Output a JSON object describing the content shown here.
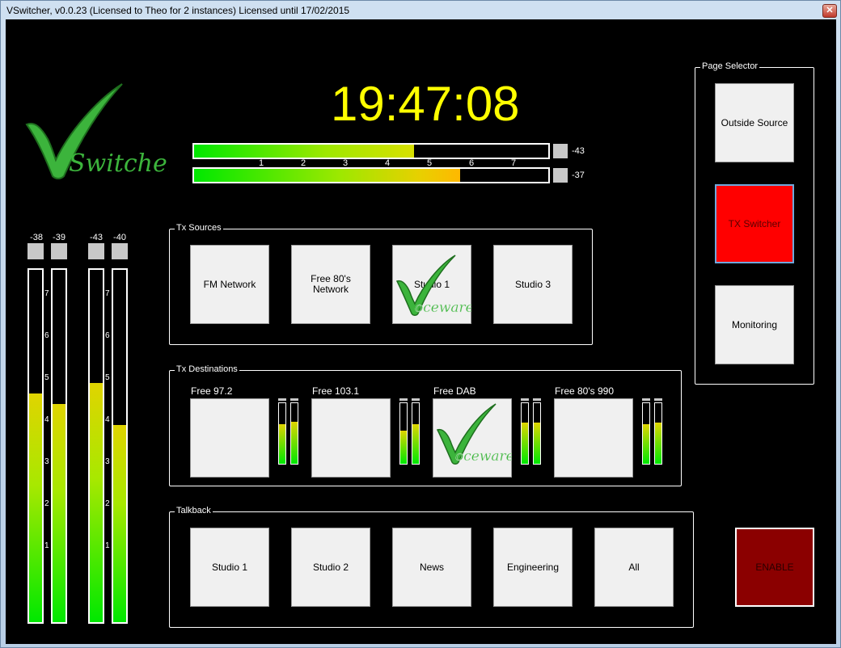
{
  "window": {
    "title": "VSwitcher, v0.0.23 (Licensed to Theo for 2 instances) Licensed until 17/02/2015",
    "close_glyph": "✕"
  },
  "clock": "19:47:08",
  "logo": {
    "text": "Switcher"
  },
  "watermark": {
    "text": "oceware"
  },
  "stereo_meters": [
    {
      "value": "-43",
      "level": 0.62
    },
    {
      "value": "-37",
      "level": 0.75
    }
  ],
  "meter_scale": [
    "1",
    "2",
    "3",
    "4",
    "5",
    "6",
    "7"
  ],
  "vu_meters": [
    {
      "value": "-38",
      "level": 0.65
    },
    {
      "value": "-39",
      "level": 0.62
    },
    {
      "value": "-43",
      "level": 0.68
    },
    {
      "value": "-40",
      "level": 0.56
    }
  ],
  "vu_scale": [
    "7",
    "6",
    "5",
    "4",
    "3",
    "2",
    "1"
  ],
  "tx_sources": {
    "label": "Tx Sources",
    "buttons": [
      "FM Network",
      "Free 80's Network",
      "Studio 1",
      "Studio 3"
    ]
  },
  "tx_destinations": {
    "label": "Tx Destinations",
    "items": [
      {
        "name": "Free 97.2",
        "levels": [
          0.65,
          0.7
        ]
      },
      {
        "name": "Free 103.1",
        "levels": [
          0.55,
          0.65
        ]
      },
      {
        "name": "Free DAB",
        "levels": [
          0.68,
          0.68
        ]
      },
      {
        "name": "Free 80's 990",
        "levels": [
          0.65,
          0.68
        ]
      }
    ]
  },
  "talkback": {
    "label": "Talkback",
    "buttons": [
      "Studio 1",
      "Studio 2",
      "News",
      "Engineering",
      "All"
    ]
  },
  "page_selector": {
    "label": "Page Selector",
    "buttons": [
      "Outside Source",
      "TX Switcher",
      "Monitoring"
    ]
  },
  "enable_button": "ENABLE",
  "colors": {
    "clock": "#ffff00",
    "active_page": "#ff0000",
    "enable": "#8b0000",
    "checkmark": "#3cb43c"
  }
}
